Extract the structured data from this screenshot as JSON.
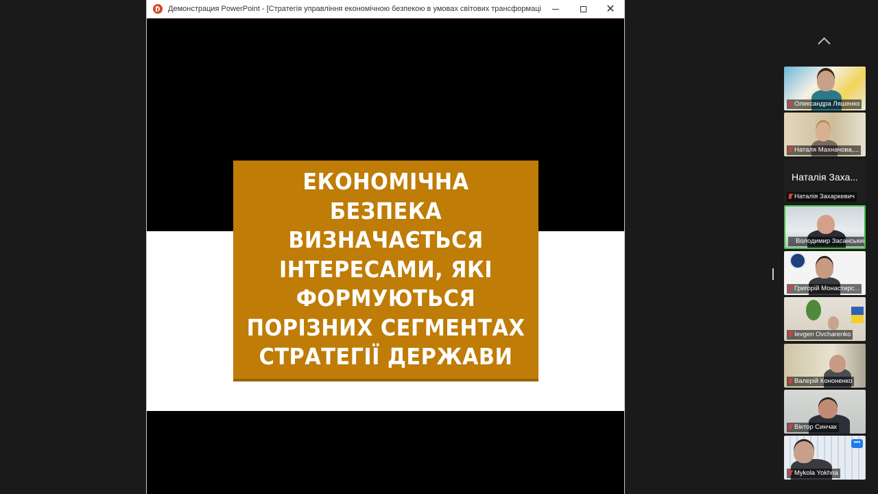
{
  "window": {
    "title": "Демонстрация PowerPoint - [Стратегія управління економічною безпекою в умовах світових трансформаці...",
    "minimize": "—",
    "maximize": "□",
    "close": "✕"
  },
  "slide": {
    "text": "Економічна безпека визначається інтересами, які формуються порізних сегментах стратегії держави",
    "box_color": "#bf7c06"
  },
  "gallery": {
    "participants": [
      {
        "name": "Олександра Ляшенко",
        "type": "video"
      },
      {
        "name": "Наталя Махначова,...",
        "type": "video"
      },
      {
        "name": "Наталія Захаркевич",
        "display_name": "Наталія Заха...",
        "type": "name-only"
      },
      {
        "name": "Володимир Засанський.",
        "type": "video",
        "active": true
      },
      {
        "name": "Григорій Монастирс...",
        "type": "video"
      },
      {
        "name": "Ievgen Ovcharenko",
        "type": "video"
      },
      {
        "name": "Валерій Кононенко",
        "type": "video"
      },
      {
        "name": "Віктор Синчак",
        "type": "video"
      },
      {
        "name": "Mykola Yokhna",
        "type": "video"
      }
    ],
    "more_button": "•••"
  }
}
